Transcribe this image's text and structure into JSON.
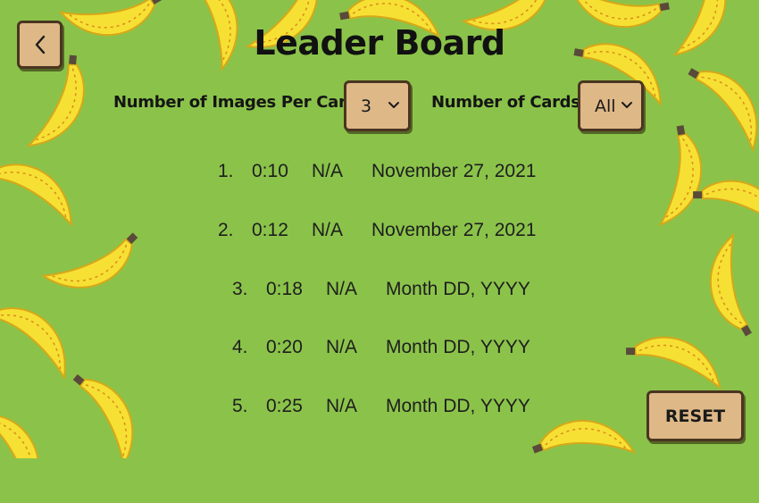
{
  "header": {
    "title": "Leader Board",
    "back_icon": "chevron-left-icon"
  },
  "filters": {
    "images_per_card_label": "Number of Images Per Card:",
    "images_per_card_value": "3",
    "cards_label": "Number of Cards:",
    "cards_value": "All"
  },
  "leaderboard": [
    {
      "rank": "1.",
      "time": "0:10",
      "status": "N/A",
      "date": "November 27, 2021"
    },
    {
      "rank": "2.",
      "time": "0:12",
      "status": "N/A",
      "date": "November 27, 2021"
    },
    {
      "rank": "3.",
      "time": "0:18",
      "status": "N/A",
      "date": "Month DD, YYYY"
    },
    {
      "rank": "4.",
      "time": "0:20",
      "status": "N/A",
      "date": "Month DD, YYYY"
    },
    {
      "rank": "5.",
      "time": "0:25",
      "status": "N/A",
      "date": "Month DD, YYYY"
    }
  ],
  "actions": {
    "reset_label": "RESET"
  },
  "colors": {
    "background": "#8bc34a",
    "button": "#deb887",
    "banana": "#f7e034"
  }
}
